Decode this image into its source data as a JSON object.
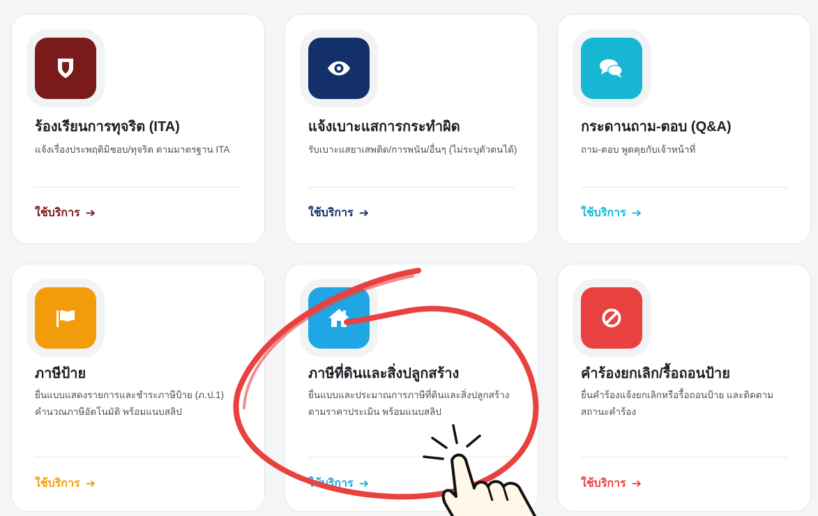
{
  "cards": [
    {
      "title": "ร้องเรียนการทุจริต (ITA)",
      "desc": "แจ้งเรื่องประพฤติมิชอบ/ทุจริต ตามมาตรฐาน ITA",
      "cta": "ใช้บริการ",
      "icon": "shield-icon",
      "tile_color": "#7b1a1a",
      "accent": "#7b1a1a"
    },
    {
      "title": "แจ้งเบาะแสการกระทำผิด",
      "desc": "รับเบาะแสยาเสพติด/การพนัน/อื่นๆ (ไม่ระบุตัวตนได้)",
      "cta": "ใช้บริการ",
      "icon": "eye-icon",
      "tile_color": "#14306b",
      "accent": "#14306b"
    },
    {
      "title": "กระดานถาม-ตอบ (Q&A)",
      "desc": "ถาม-ตอบ พูดคุยกับเจ้าหน้าที่",
      "cta": "ใช้บริการ",
      "icon": "chat-bubbles-icon",
      "tile_color": "#17b6d3",
      "accent": "#17b6d3"
    },
    {
      "title": "ภาษีป้าย",
      "desc": "ยื่นแบบแสดงรายการและชำระภาษีป้าย (ภ.ป.1) คำนวณภาษีอัตโนมัติ พร้อมแนบสลิป",
      "cta": "ใช้บริการ",
      "icon": "flag-icon",
      "tile_color": "#f39c0b",
      "accent": "#f39c0b"
    },
    {
      "title": "ภาษีที่ดินและสิ่งปลูกสร้าง",
      "desc": "ยื่นแบบและประมาณการภาษีที่ดินและสิ่งปลูกสร้างตามราคาประเมิน พร้อมแนบสลิป",
      "cta": "ใช้บริการ",
      "icon": "home-icon",
      "tile_color": "#1ea7e4",
      "accent": "#1ea7e4"
    },
    {
      "title": "คำร้องยกเลิก/รื้อถอนป้าย",
      "desc": "ยื่นคำร้องแจ้งยกเลิกหรือรื้อถอนป้าย และติดตามสถานะคำร้อง",
      "cta": "ใช้บริการ",
      "icon": "ban-icon",
      "tile_color": "#e8413f",
      "accent": "#e8413f"
    }
  ],
  "annotation": {
    "circle_color": "#e8413f",
    "pointer_icon": "pointing-hand-icon"
  }
}
